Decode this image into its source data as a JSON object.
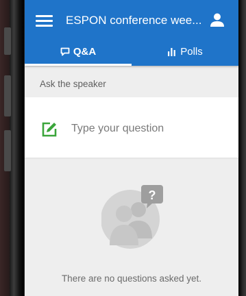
{
  "app": {
    "title": "ESPON conference wee...",
    "menu_icon": "hamburger-menu-icon",
    "account_icon": "person-icon"
  },
  "tabs": [
    {
      "label": "Q&A",
      "icon": "chat-bubble-icon",
      "active": true
    },
    {
      "label": "Polls",
      "icon": "bar-chart-icon",
      "active": false
    }
  ],
  "ask": {
    "section_label": "Ask the speaker",
    "placeholder": "Type your question",
    "icon": "edit-compose-icon"
  },
  "empty_state": {
    "icon": "people-question-icon",
    "message": "There are no questions asked yet."
  },
  "colors": {
    "primary": "#1f74c9",
    "accent_green": "#3aa53a",
    "background": "#eeeeee",
    "card": "#ffffff"
  }
}
